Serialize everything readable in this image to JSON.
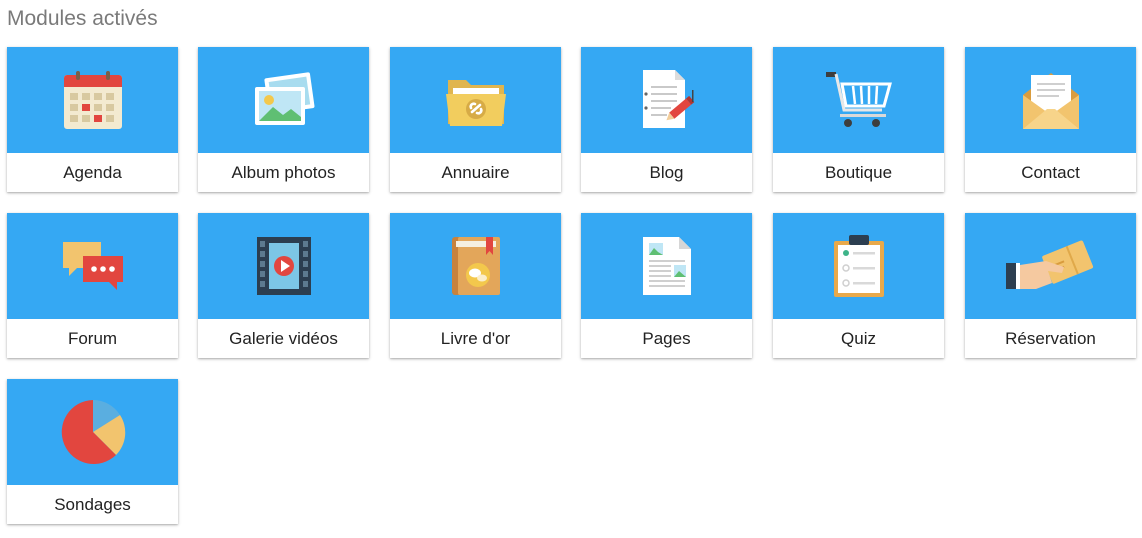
{
  "section": {
    "title": "Modules activés"
  },
  "theme": {
    "tile_background": "#35a8f3",
    "label_color": "#222222",
    "title_color": "#7a7a7a"
  },
  "modules": [
    {
      "label": "Agenda",
      "icon": "calendar-icon"
    },
    {
      "label": "Album photos",
      "icon": "photos-icon"
    },
    {
      "label": "Annuaire",
      "icon": "folder-link-icon"
    },
    {
      "label": "Blog",
      "icon": "document-pencil-icon"
    },
    {
      "label": "Boutique",
      "icon": "shopping-cart-icon"
    },
    {
      "label": "Contact",
      "icon": "envelope-icon"
    },
    {
      "label": "Forum",
      "icon": "chat-bubbles-icon"
    },
    {
      "label": "Galerie vidéos",
      "icon": "video-film-icon"
    },
    {
      "label": "Livre d'or",
      "icon": "guestbook-icon"
    },
    {
      "label": "Pages",
      "icon": "page-icon"
    },
    {
      "label": "Quiz",
      "icon": "clipboard-checklist-icon"
    },
    {
      "label": "Réservation",
      "icon": "ticket-hand-icon"
    },
    {
      "label": "Sondages",
      "icon": "pie-chart-icon"
    }
  ]
}
